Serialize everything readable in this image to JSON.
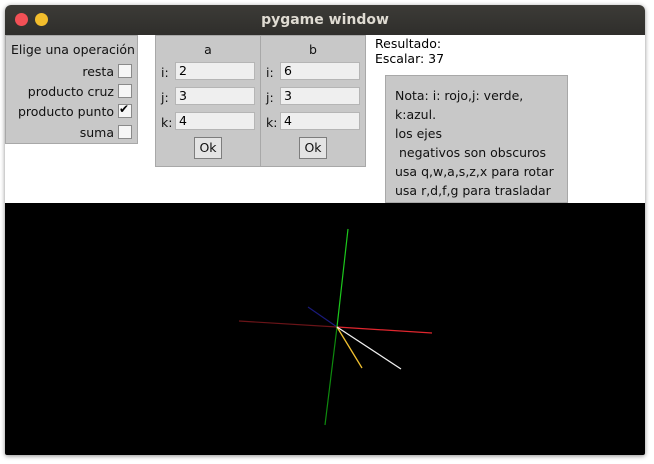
{
  "window": {
    "title": "pygame window"
  },
  "operations": {
    "title": "Elige una operación",
    "items": [
      {
        "label": "resta",
        "checked": false
      },
      {
        "label": "producto cruz",
        "checked": false
      },
      {
        "label": "producto punto",
        "checked": true
      },
      {
        "label": "suma",
        "checked": false
      }
    ]
  },
  "vector_a": {
    "header": "a",
    "i_label": "i:",
    "j_label": "j:",
    "k_label": "k:",
    "i": "2",
    "j": "3",
    "k": "4",
    "ok": "Ok"
  },
  "vector_b": {
    "header": "b",
    "i_label": "i:",
    "j_label": "j:",
    "k_label": "k:",
    "i": "6",
    "j": "3",
    "k": "4",
    "ok": "Ok"
  },
  "result": {
    "label": "Resultado:",
    "value_line": "Escalar: 37"
  },
  "note": {
    "lines": [
      "Nota: i: rojo,j: verde,",
      "k:azul.",
      "los ejes",
      " negativos son obscuros",
      "usa q,w,a,s,z,x para rotar",
      "usa r,d,f,g para trasladar"
    ]
  },
  "scene_colors": {
    "i_axis": "#e0262e",
    "i_axis_neg": "#6a1418",
    "j_axis": "#1cc81c",
    "j_axis_neg": "#0e8a0e",
    "k_axis_neg": "#1a1a7a",
    "vector_a": "#f0c030",
    "vector_b": "#f0f0f0"
  }
}
